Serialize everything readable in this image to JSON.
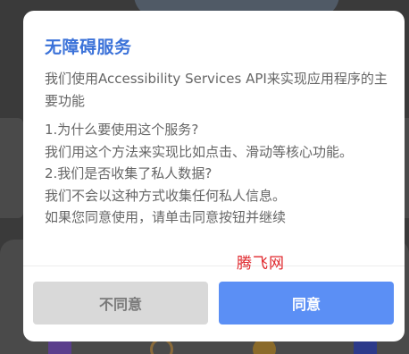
{
  "dialog": {
    "title": "无障碍服务",
    "intro": "我们使用Accessibility Services API来实现应用程序的主要功能",
    "q1": "1.为什么要使用这个服务?",
    "a1": "我们用这个方法来实现比如点击、滑动等核心功能。",
    "q2": "2.我们是否收集了私人数据?",
    "a2": "我们不会以这种方式收集任何私人信息。",
    "instruction": "如果您同意使用，请单击同意按钮并继续",
    "disagree_label": "不同意",
    "agree_label": "同意"
  },
  "watermark": "腾飞网",
  "colors": {
    "title": "#3b72d9",
    "agree_button": "#5b8ff5",
    "disagree_button": "#d9d9d9",
    "watermark": "#e0262b"
  },
  "background_icons": [
    "bar-chart-icon",
    "clock-icon",
    "fan-icon",
    "grid-icon"
  ]
}
